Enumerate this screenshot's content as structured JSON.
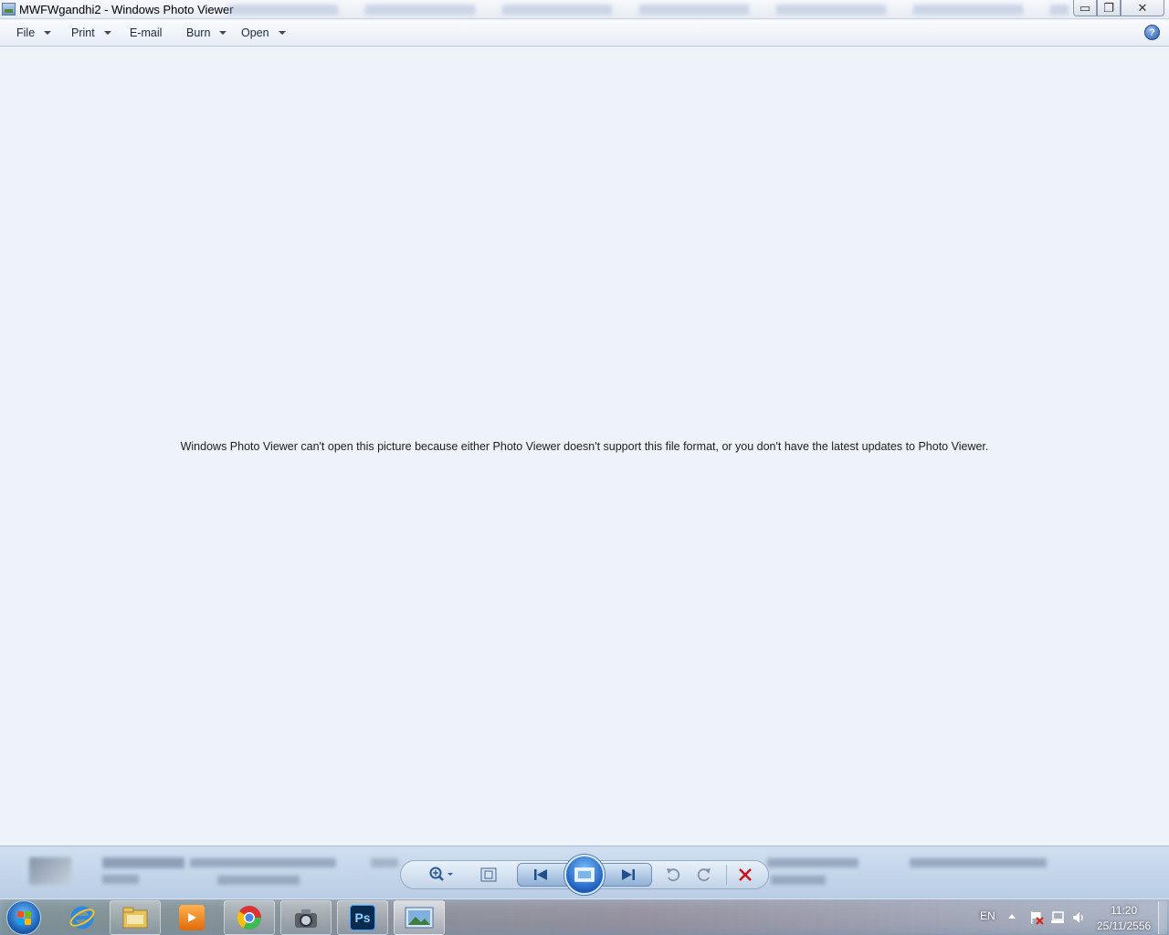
{
  "window": {
    "title": "MWFWgandhi2 - Windows Photo Viewer",
    "minimize_glyph": "▭",
    "maximize_glyph": "❐",
    "close_glyph": "✕"
  },
  "menu": {
    "items": [
      {
        "label": "File",
        "has_dropdown": true
      },
      {
        "label": "Print",
        "has_dropdown": true
      },
      {
        "label": "E-mail",
        "has_dropdown": false
      },
      {
        "label": "Burn",
        "has_dropdown": true
      },
      {
        "label": "Open",
        "has_dropdown": true
      }
    ],
    "help_glyph": "?"
  },
  "viewer": {
    "message": "Windows Photo Viewer can't open this picture because either Photo Viewer doesn't support this file format, or you don't have the latest updates to Photo Viewer."
  },
  "controls": {
    "icons": [
      "zoom-icon",
      "actual-size-icon",
      "previous-icon",
      "slideshow-icon",
      "next-icon",
      "rotate-counterclockwise-icon",
      "rotate-clockwise-icon",
      "delete-icon"
    ],
    "delete_color": "#c8121a"
  },
  "taskbar": {
    "apps": [
      "start-orb",
      "internet-explorer-icon",
      "file-explorer-icon",
      "media-player-icon",
      "chrome-icon",
      "camera-app-icon",
      "photoshop-icon",
      "photo-viewer-icon"
    ],
    "photoshop_label": "Ps",
    "language": "EN",
    "time": "11:20",
    "date": "25/11/2556"
  },
  "colors": {
    "background": "#eef2f9",
    "accent": "#2d5fae"
  }
}
